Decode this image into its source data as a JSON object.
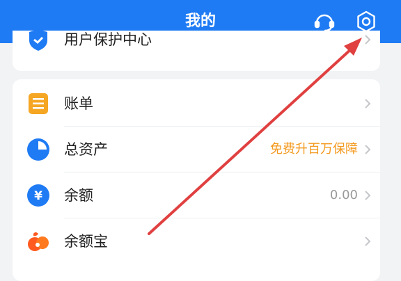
{
  "header": {
    "title": "我的",
    "icons": [
      "customer-service-icon",
      "settings-icon"
    ],
    "background": "#1f7bf4"
  },
  "partial_item": {
    "label": "用户保护中心",
    "icon": "shield-icon"
  },
  "menu": {
    "bill": {
      "label": "账单",
      "icon": "bill-icon",
      "color": "#f5a623"
    },
    "total_assets": {
      "label": "总资产",
      "value": "免费升百万保障",
      "icon": "pie-chart-icon",
      "color": "#1f7bf4"
    },
    "balance": {
      "label": "余额",
      "value": "0.00",
      "icon": "yuan-icon",
      "color": "#1f7bf4"
    },
    "yuebao": {
      "label": "余额宝",
      "icon": "yuebao-icon",
      "color": "#ff5a1f"
    }
  },
  "annotation": {
    "arrow_color": "#e04040",
    "points_to": "settings-icon"
  }
}
